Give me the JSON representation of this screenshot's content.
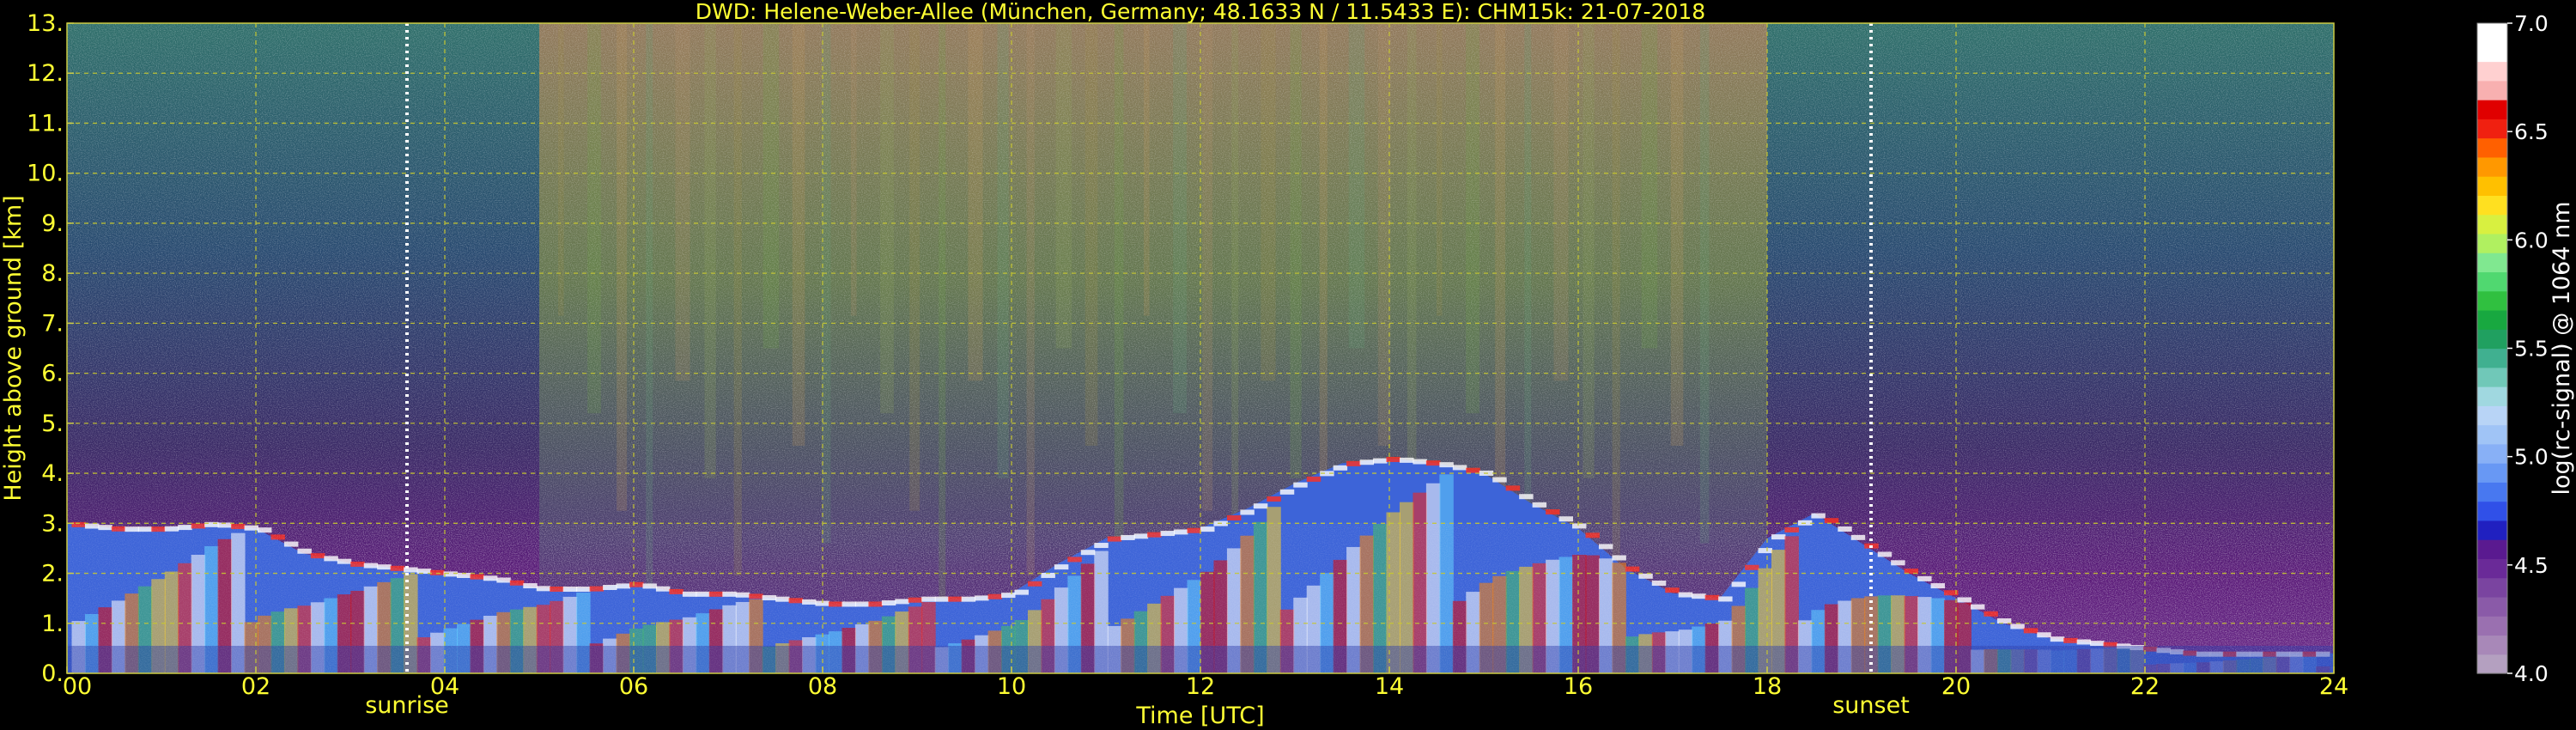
{
  "chart_data": {
    "type": "heatmap",
    "title": "DWD: Helene-Weber-Allee (München, Germany; 48.1633 N / 11.5433 E):    CHM15k: 21-07-2018",
    "xlabel": "Time [UTC]",
    "ylabel": "Height above ground [km]",
    "xlim": [
      0,
      24
    ],
    "ylim": [
      0,
      13
    ],
    "x_ticks": [
      0,
      2,
      4,
      6,
      8,
      10,
      12,
      14,
      16,
      18,
      20,
      22,
      24
    ],
    "x_tick_labels": [
      "00",
      "02",
      "04",
      "06",
      "08",
      "10",
      "12",
      "14",
      "16",
      "18",
      "20",
      "22",
      "24"
    ],
    "y_ticks": [
      0,
      1,
      2,
      3,
      4,
      5,
      6,
      7,
      8,
      9,
      10,
      11,
      12,
      13
    ],
    "y_tick_labels": [
      "0.",
      "1.",
      "2.",
      "3.",
      "4.",
      "5.",
      "6.",
      "7.",
      "8.",
      "9.",
      "10.",
      "11.",
      "12.",
      "13."
    ],
    "grid": true,
    "colorbar": {
      "label": "log(rc-signal) @ 1064 nm",
      "range": [
        4.0,
        7.0
      ],
      "ticks": [
        4.0,
        4.5,
        5.0,
        5.5,
        6.0,
        6.5,
        7.0
      ],
      "tick_labels": [
        "4.0",
        "4.5",
        "5.0",
        "5.5",
        "6.0",
        "6.5",
        "7.0"
      ],
      "colors": [
        "#b4a0c0",
        "#a888b8",
        "#9a70b0",
        "#8a5aa8",
        "#7a44a0",
        "#6a2a98",
        "#5a1a90",
        "#2020c0",
        "#3050e8",
        "#4878f0",
        "#6898f4",
        "#88b0f6",
        "#a0c4f6",
        "#b8d4f6",
        "#a0d8e0",
        "#70c8b8",
        "#40b090",
        "#20a060",
        "#18a840",
        "#30c040",
        "#50d870",
        "#80e890",
        "#b0f060",
        "#d8f040",
        "#ffe020",
        "#ffc000",
        "#ff9800",
        "#ff6000",
        "#f02010",
        "#e00000",
        "#f8b0b0",
        "#ffd0d0",
        "#ffffff",
        "#ffffff"
      ]
    },
    "markers": [
      {
        "label": "sunrise",
        "x": 3.6
      },
      {
        "label": "sunset",
        "x": 19.1
      }
    ],
    "boundary_layer": {
      "time_h": [
        0,
        0.5,
        1,
        1.5,
        2,
        2.5,
        3,
        3.5,
        4,
        4.5,
        5,
        5.5,
        6,
        6.5,
        7,
        7.5,
        8,
        8.5,
        9,
        9.5,
        10,
        10.5,
        11,
        11.5,
        12,
        12.5,
        13,
        13.5,
        14,
        14.5,
        15,
        15.5,
        16,
        16.5,
        17,
        17.5,
        18,
        18.5,
        19,
        19.5,
        20,
        20.5,
        21,
        21.5,
        22,
        22.5,
        23,
        23.5,
        24
      ],
      "top_km": [
        3.0,
        2.9,
        2.9,
        3.0,
        2.9,
        2.4,
        2.2,
        2.1,
        2.0,
        1.9,
        1.7,
        1.7,
        1.8,
        1.6,
        1.6,
        1.5,
        1.4,
        1.4,
        1.5,
        1.5,
        1.6,
        2.2,
        2.7,
        2.8,
        2.9,
        3.3,
        3.8,
        4.2,
        4.3,
        4.2,
        4.0,
        3.4,
        2.9,
        2.1,
        1.6,
        1.5,
        2.7,
        3.2,
        2.6,
        2.0,
        1.5,
        1.0,
        0.7,
        0.6,
        0.5,
        0.4,
        0.4,
        0.4,
        0.4
      ]
    }
  }
}
